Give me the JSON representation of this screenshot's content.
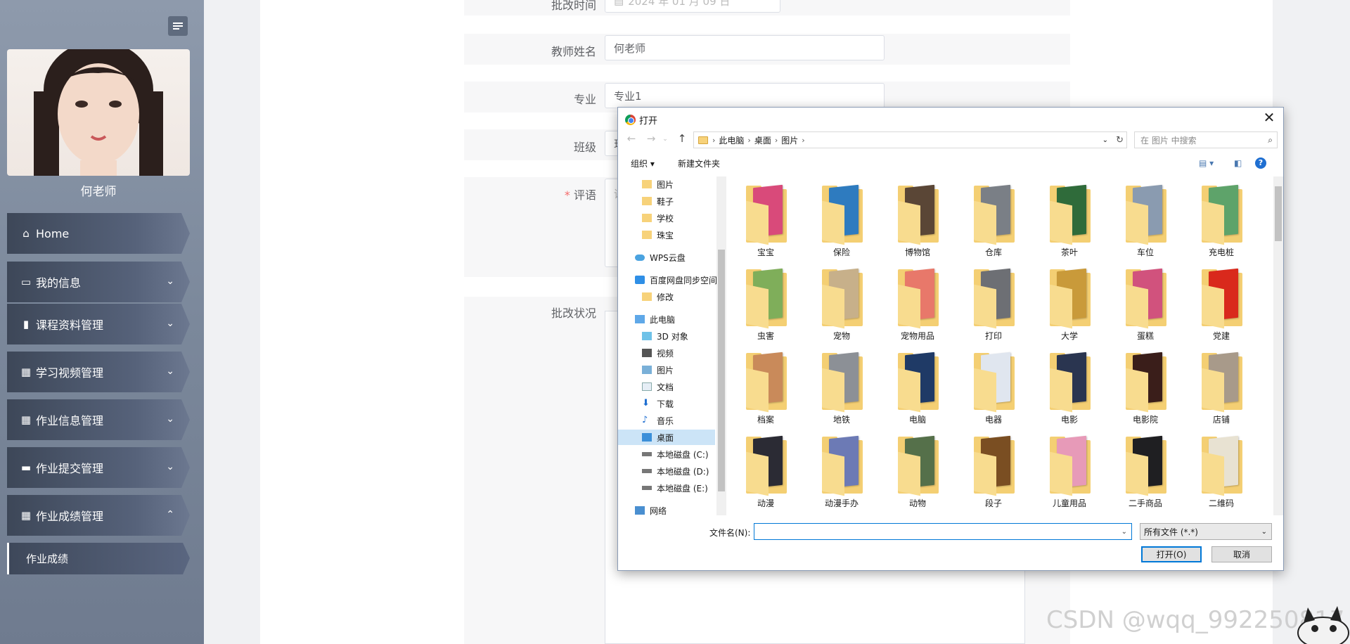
{
  "sidebar": {
    "user_name": "何老师",
    "menu": [
      {
        "label": "Home",
        "icon": "home-icon"
      },
      {
        "label": "我的信息",
        "icon": "id-card-icon"
      },
      {
        "label": "课程资料管理",
        "icon": "bar-chart-icon"
      },
      {
        "label": "学习视频管理",
        "icon": "grid-icon"
      },
      {
        "label": "作业信息管理",
        "icon": "grid-icon"
      },
      {
        "label": "作业提交管理",
        "icon": "briefcase-icon"
      },
      {
        "label": "作业成绩管理",
        "icon": "grid-icon"
      }
    ],
    "sub_item": "作业成绩"
  },
  "form": {
    "date_label": "批改时间",
    "date_value": "2024 年 01 月 09 日",
    "teacher_label": "教师姓名",
    "teacher_value": "何老师",
    "major_label": "专业",
    "major_value": "专业1",
    "class_label": "班级",
    "class_value_partial": "现",
    "comment_label": "评语",
    "comment_required": "*",
    "comment_placeholder_partial": "评",
    "status_label": "批改状况"
  },
  "dialog": {
    "title": "打开",
    "close": "✕",
    "breadcrumb": [
      "此电脑",
      "桌面",
      "图片"
    ],
    "search_placeholder": "在 图片 中搜索",
    "organize": "组织 ▾",
    "new_folder": "新建文件夹",
    "nav_items": [
      {
        "label": "图片",
        "icon": "folder-icon"
      },
      {
        "label": "鞋子",
        "icon": "folder-icon"
      },
      {
        "label": "学校",
        "icon": "folder-icon"
      },
      {
        "label": "珠宝",
        "icon": "folder-icon"
      },
      {
        "label": "WPS云盘",
        "icon": "cloud-icon"
      },
      {
        "label": "百度网盘同步空间",
        "icon": "baidu-icon"
      },
      {
        "label": "修改",
        "icon": "folder-icon"
      },
      {
        "label": "此电脑",
        "icon": "computer-icon"
      },
      {
        "label": "3D 对象",
        "icon": "cube-icon"
      },
      {
        "label": "视频",
        "icon": "video-icon"
      },
      {
        "label": "图片",
        "icon": "picture-icon"
      },
      {
        "label": "文档",
        "icon": "document-icon"
      },
      {
        "label": "下载",
        "icon": "download-icon"
      },
      {
        "label": "音乐",
        "icon": "music-icon"
      },
      {
        "label": "桌面",
        "icon": "desktop-icon"
      },
      {
        "label": "本地磁盘 (C:)",
        "icon": "disk-icon"
      },
      {
        "label": "本地磁盘 (D:)",
        "icon": "disk-icon"
      },
      {
        "label": "本地磁盘 (E:)",
        "icon": "disk-icon"
      },
      {
        "label": "网络",
        "icon": "network-icon"
      }
    ],
    "folders": [
      {
        "label": "宝宝",
        "color": "#d94a7a"
      },
      {
        "label": "保险",
        "color": "#2e7bbf"
      },
      {
        "label": "博物馆",
        "color": "#5a4636"
      },
      {
        "label": "仓库",
        "color": "#7a7f86"
      },
      {
        "label": "茶叶",
        "color": "#2f6b3a"
      },
      {
        "label": "车位",
        "color": "#8a9bb0"
      },
      {
        "label": "充电桩",
        "color": "#5ea36a"
      },
      {
        "label": "虫害",
        "color": "#7fae5a"
      },
      {
        "label": "宠物",
        "color": "#c7b08a"
      },
      {
        "label": "宠物用品",
        "color": "#e8786a"
      },
      {
        "label": "打印",
        "color": "#6d6f74"
      },
      {
        "label": "大学",
        "color": "#c99a3a"
      },
      {
        "label": "蛋糕",
        "color": "#d1527d"
      },
      {
        "label": "党建",
        "color": "#d9291c"
      },
      {
        "label": "档案",
        "color": "#c98a5a"
      },
      {
        "label": "地铁",
        "color": "#8c9096"
      },
      {
        "label": "电脑",
        "color": "#1f3a66"
      },
      {
        "label": "电器",
        "color": "#e0e6ef"
      },
      {
        "label": "电影",
        "color": "#2a3550"
      },
      {
        "label": "电影院",
        "color": "#3a1e1a"
      },
      {
        "label": "店铺",
        "color": "#a89a8a"
      },
      {
        "label": "动漫",
        "color": "#2b2b34"
      },
      {
        "label": "动漫手办",
        "color": "#6c7ab5"
      },
      {
        "label": "动物",
        "color": "#55704a"
      },
      {
        "label": "段子",
        "color": "#7a4e22"
      },
      {
        "label": "儿童用品",
        "color": "#e79ab8"
      },
      {
        "label": "二手商品",
        "color": "#1f1f22"
      },
      {
        "label": "二维码",
        "color": "#e8e2d2"
      }
    ],
    "filename_label": "文件名(N):",
    "filename_value": "",
    "filetype": "所有文件 (*.*)",
    "open_btn": "打开(O)",
    "cancel_btn": "取消"
  },
  "watermark": "CSDN @wqq_992250817"
}
